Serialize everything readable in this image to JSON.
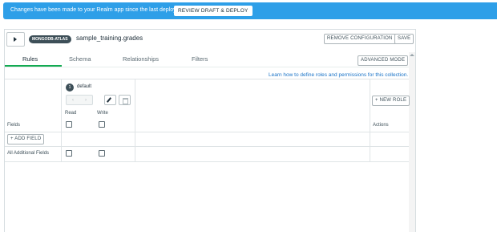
{
  "banner": {
    "message": "Changes have been made to your Realm app since the last deploy.",
    "review_button": "REVIEW DRAFT & DEPLOY",
    "color": "#2e9fe8"
  },
  "header": {
    "badge": "MONGODB-ATLAS",
    "collection": "sample_training.grades",
    "remove_button": "REMOVE CONFIGURATION",
    "save_button": "SAVE"
  },
  "tabs": [
    {
      "label": "Rules",
      "active": true
    },
    {
      "label": "Schema",
      "active": false
    },
    {
      "label": "Relationships",
      "active": false
    },
    {
      "label": "Filters",
      "active": false
    }
  ],
  "advanced_mode": "ADVANCED MODE",
  "help_link": "Learn how to define roles and permissions for this collection.",
  "role": {
    "index": "1",
    "name": "default",
    "prev": "‹",
    "next": "›"
  },
  "new_role_button": "+ NEW ROLE",
  "columns": {
    "fields": "Fields",
    "read": "Read",
    "write": "Write",
    "actions": "Actions"
  },
  "add_field_button": "+ ADD FIELD",
  "rows": [
    {
      "label": "All Additional Fields",
      "read": false,
      "write": false
    }
  ],
  "accent_green": "#13aa52"
}
